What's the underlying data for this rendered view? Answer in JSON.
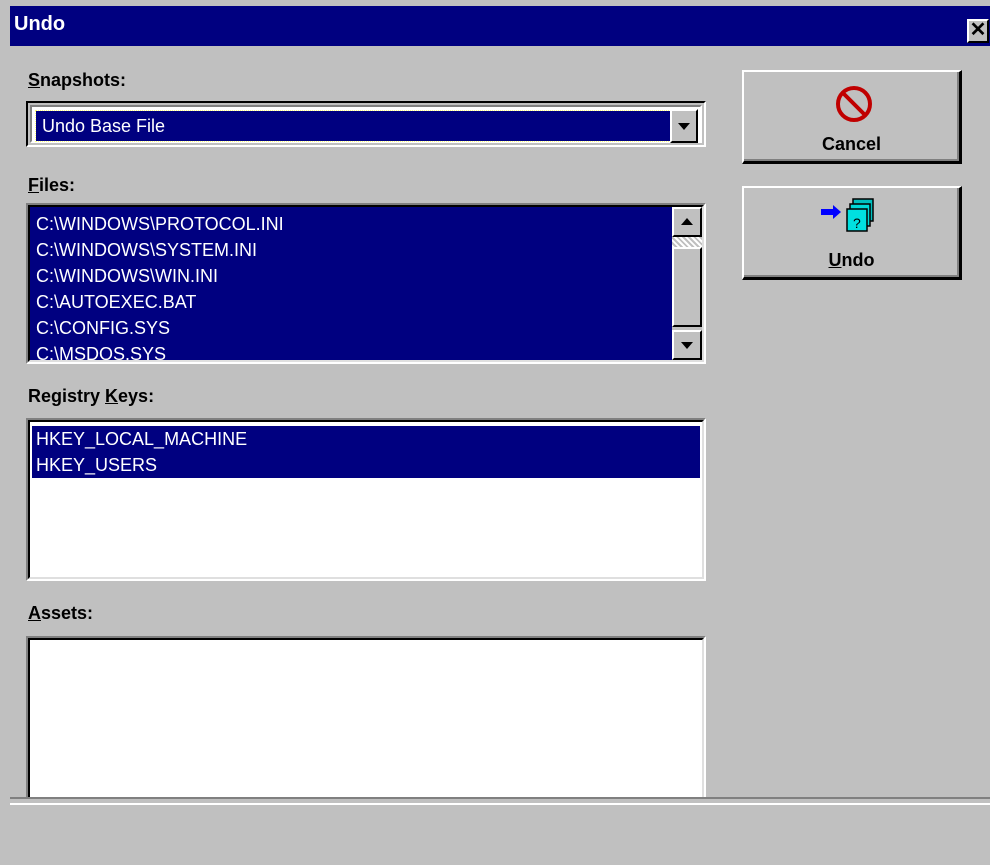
{
  "window": {
    "title": "Undo",
    "close_glyph": "✕"
  },
  "snapshots": {
    "label_prefix": "",
    "label_accel": "S",
    "label_rest": "napshots:",
    "selected": "Undo Base File"
  },
  "files": {
    "label_accel": "F",
    "label_rest": "iles:",
    "items": [
      "C:\\WINDOWS\\PROTOCOL.INI",
      "C:\\WINDOWS\\SYSTEM.INI",
      "C:\\WINDOWS\\WIN.INI",
      "C:\\AUTOEXEC.BAT",
      "C:\\CONFIG.SYS",
      "C:\\MSDOS.SYS"
    ]
  },
  "registry": {
    "label_prefix": "Registry ",
    "label_accel": "K",
    "label_rest": "eys:",
    "items": [
      "HKEY_LOCAL_MACHINE",
      "HKEY_USERS"
    ]
  },
  "assets": {
    "label_accel": "A",
    "label_rest": "ssets:",
    "items": []
  },
  "buttons": {
    "cancel": {
      "label": "Cancel",
      "icon": "no-symbol-icon"
    },
    "undo": {
      "label_accel": "U",
      "label_rest": "ndo",
      "icon": "undo-files-icon"
    }
  },
  "colors": {
    "selection": "#000080",
    "face": "#c0c0c0",
    "cancel_icon": "#c00000"
  }
}
